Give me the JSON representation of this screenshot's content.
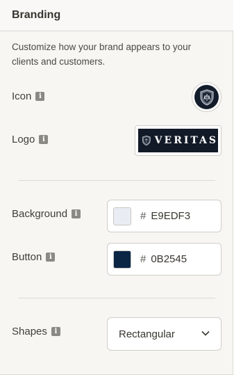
{
  "panel": {
    "title": "Branding",
    "description": "Customize how your brand appears to your clients and customers."
  },
  "icon_row": {
    "label": "Icon",
    "info_icon": "info-icon"
  },
  "logo_row": {
    "label": "Logo",
    "info_icon": "info-icon",
    "logo_text": "VERITAS"
  },
  "background_row": {
    "label": "Background",
    "hash": "#",
    "value": "E9EDF3",
    "swatch_color": "#E9EDF3"
  },
  "button_row": {
    "label": "Button",
    "hash": "#",
    "value": "0B2545",
    "swatch_color": "#0B2545"
  },
  "shapes_row": {
    "label": "Shapes",
    "selected": "Rectangular"
  }
}
